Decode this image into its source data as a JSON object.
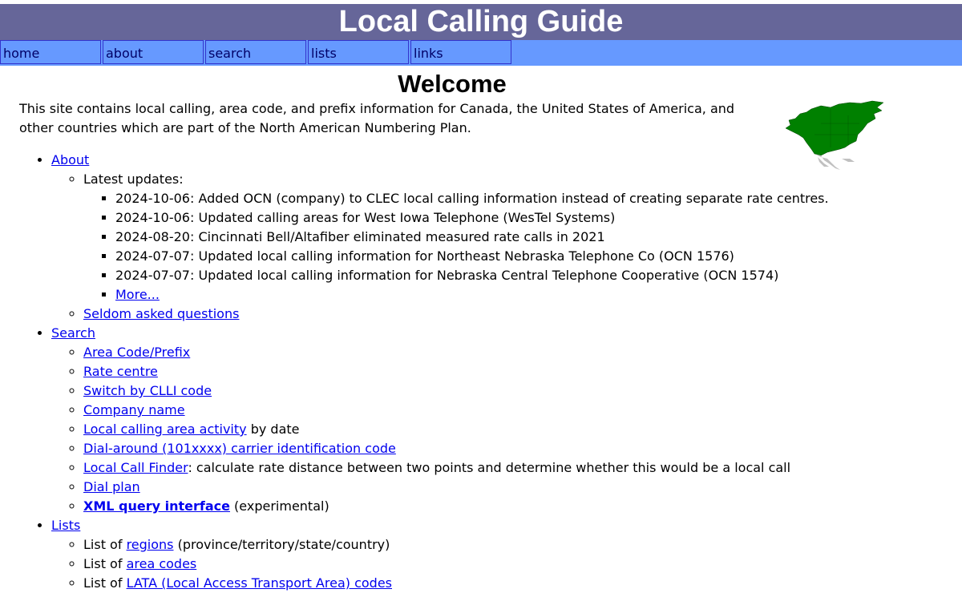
{
  "site": {
    "title": "Local Calling Guide"
  },
  "nav": {
    "items": [
      {
        "label": "home"
      },
      {
        "label": "about"
      },
      {
        "label": "search"
      },
      {
        "label": "lists"
      },
      {
        "label": "links"
      }
    ]
  },
  "main": {
    "heading": "Welcome",
    "intro": "This site contains local calling, area code, and prefix information for Canada, the United States of America, and other countries which are part of the North American Numbering Plan."
  },
  "about": {
    "link": "About",
    "latest_label": "Latest updates:",
    "updates": [
      "2024-10-06: Added OCN (company) to CLEC local calling information instead of creating separate rate centres.",
      "2024-10-06: Updated calling areas for West Iowa Telephone (WesTel Systems)",
      "2024-08-20: Cincinnati Bell/Altafiber eliminated measured rate calls in 2021",
      "2024-07-07: Updated local calling information for Northeast Nebraska Telephone Co (OCN 1576)",
      "2024-07-07: Updated local calling information for Nebraska Central Telephone Cooperative (OCN 1574)"
    ],
    "more": "More...",
    "faq": "Seldom asked questions"
  },
  "search": {
    "link": "Search",
    "area_code_prefix": "Area Code/Prefix",
    "rate_centre": "Rate centre",
    "switch_clli": "Switch by CLLI code",
    "company_name": "Company name",
    "activity_link": "Local calling area activity",
    "activity_suffix": " by date",
    "dial_around": "Dial-around (101xxxx) carrier identification code",
    "call_finder_link": "Local Call Finder",
    "call_finder_suffix": ": calculate rate distance between two points and determine whether this would be a local call",
    "dial_plan": "Dial plan",
    "xml_link": "XML query interface",
    "xml_suffix": " (experimental)"
  },
  "lists": {
    "link": "Lists",
    "list_of": "List of ",
    "regions_link": "regions",
    "regions_suffix": " (province/territory/state/country)",
    "area_codes_link": "area codes",
    "lata_link": "LATA (Local Access Transport Area) codes"
  },
  "colors": {
    "title_bar": "#666699",
    "nav_bar": "#6699ff",
    "link": "#0000ee",
    "map_land": "#008000"
  }
}
